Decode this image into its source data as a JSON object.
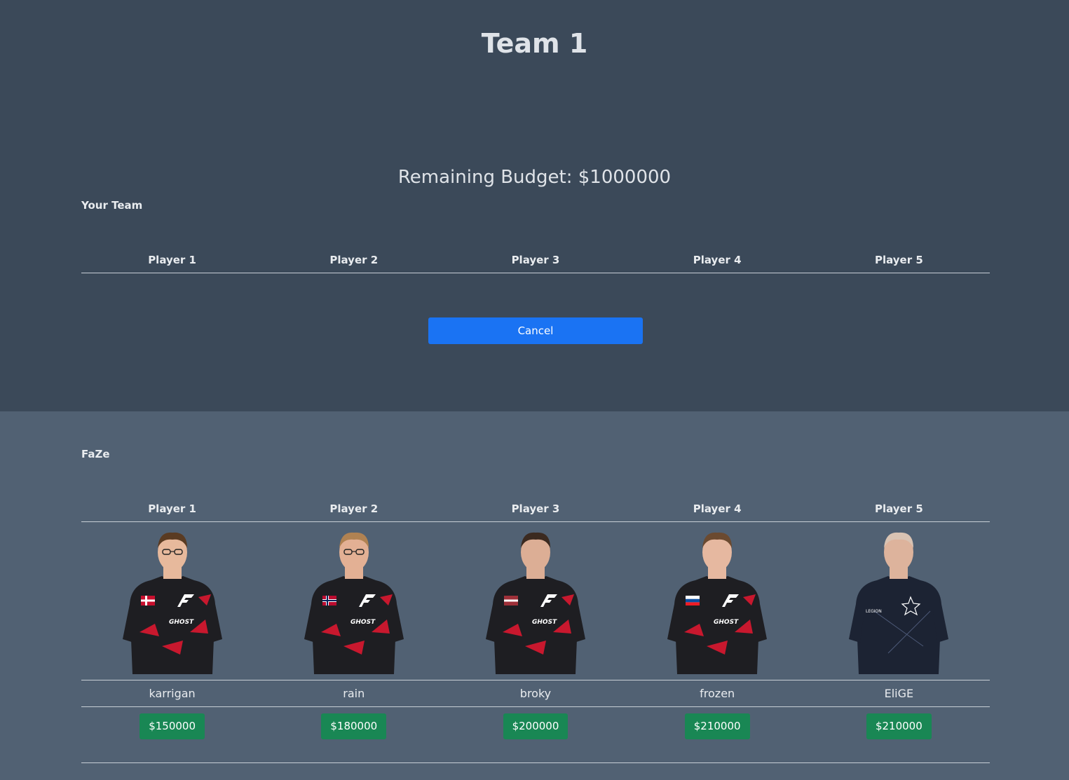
{
  "title": "Team 1",
  "budget": "Remaining Budget: $1000000",
  "your_team": {
    "label": "Your Team",
    "headers": [
      "Player 1",
      "Player 2",
      "Player 3",
      "Player 4",
      "Player 5"
    ]
  },
  "cancel_label": "Cancel",
  "faze": {
    "label": "FaZe",
    "headers": [
      "Player 1",
      "Player 2",
      "Player 3",
      "Player 4",
      "Player 5"
    ],
    "players": [
      {
        "name": "karrigan",
        "price": "$150000",
        "jersey": "faze",
        "flag": "denmark"
      },
      {
        "name": "rain",
        "price": "$180000",
        "jersey": "faze",
        "flag": "norway"
      },
      {
        "name": "broky",
        "price": "$200000",
        "jersey": "faze",
        "flag": "latvia"
      },
      {
        "name": "frozen",
        "price": "$210000",
        "jersey": "faze",
        "flag": "slovakia"
      },
      {
        "name": "EliGE",
        "price": "$210000",
        "jersey": "liquid",
        "flag": "none"
      }
    ]
  },
  "colors": {
    "top_bg": "#3b4959",
    "bottom_bg": "#516173",
    "cancel_button": "#1a73f3",
    "price_button": "#198754"
  }
}
